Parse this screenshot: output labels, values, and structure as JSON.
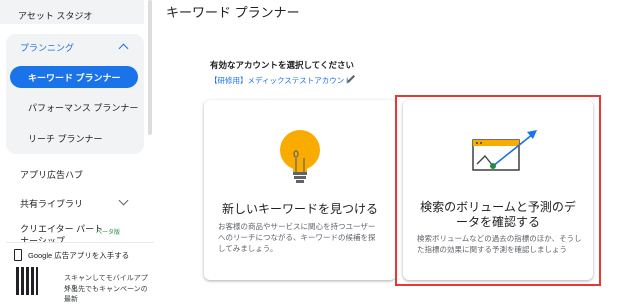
{
  "sidebar": {
    "top_item": "アセット スタジオ",
    "planning": "プランニング",
    "keyword_planner": "キーワード プランナー",
    "performance_planner": "パフォーマンス プランナー",
    "reach_planner": "リーチ プランナー",
    "app_ad_hub": "アプリ広告ハブ",
    "shared_library": "共有ライブラリ",
    "creator_partnership_line1": "クリエイター パート",
    "creator_partnership_line2": "ナーシップ",
    "beta_badge": "ベータ版",
    "app_promo_title": "Google 広告アプリを入手する",
    "app_promo_line1": "スキャンしてモバイルアプリを",
    "app_promo_line2": "外出先でもキャンペーンの最新"
  },
  "main": {
    "title": "キーワード プランナー",
    "account_label": "有効なアカウントを選択してください",
    "account_name": "【研修用】メディックステストアカウント"
  },
  "cards": [
    {
      "title_line1": "新しいキーワードを見つける",
      "desc_line1": "お客様の商品やサービスに関心を持つユーザー",
      "desc_line2": "へのリーチにつながる、キーワードの候補を探",
      "desc_line3": "してみましょう。"
    },
    {
      "title_line1": "検索のボリュームと予測のデ",
      "title_line2": "ータを確認する",
      "desc_line1": "検索ボリュームなどの過去の指標のほか、そうし",
      "desc_line2": "た指標の効果に関する予測を確認しましょう"
    }
  ],
  "colors": {
    "accent": "#1a73e8",
    "highlight_border": "#e53935",
    "bulb": "#f9ab00"
  }
}
